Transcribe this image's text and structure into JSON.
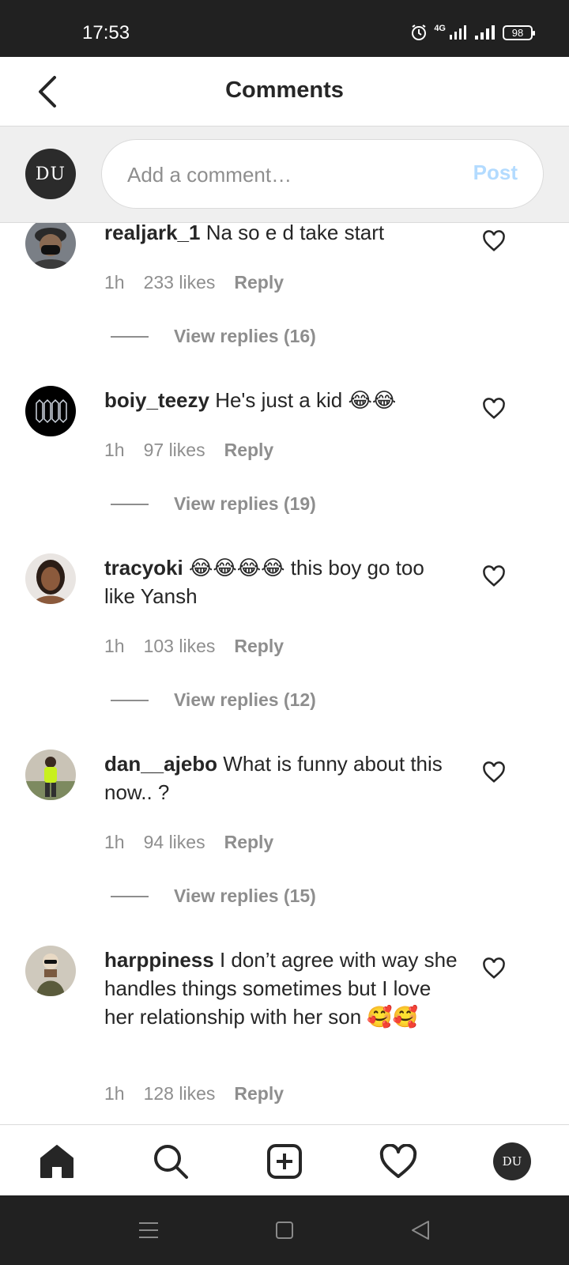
{
  "status_bar": {
    "time": "17:53",
    "network": "4G",
    "battery": "98"
  },
  "header": {
    "title": "Comments"
  },
  "composer": {
    "avatar_initials": "DU",
    "placeholder": "Add a comment…",
    "post_label": "Post"
  },
  "comments": [
    {
      "username": "realjark_1",
      "text": "Na so e d take start",
      "time": "1h",
      "likes": "233 likes",
      "reply": "Reply",
      "view_replies": "View replies (16)"
    },
    {
      "username": "boiy_teezy",
      "text": "He's just a kid 😂😂",
      "time": "1h",
      "likes": "97 likes",
      "reply": "Reply",
      "view_replies": "View replies (19)"
    },
    {
      "username": "tracyoki",
      "text": "😂😂😂😂 this boy go too like Yansh",
      "time": "1h",
      "likes": "103 likes",
      "reply": "Reply",
      "view_replies": "View replies (12)"
    },
    {
      "username": "dan__ajebo",
      "text": "What is funny about this now.. ?",
      "time": "1h",
      "likes": "94 likes",
      "reply": "Reply",
      "view_replies": "View replies (15)"
    },
    {
      "username": "harppiness",
      "text": "I don’t agree with way she handles things sometimes but I love her relationship with her son 🥰🥰",
      "time": "1h",
      "likes": "128 likes",
      "reply": "Reply"
    }
  ],
  "bottom_nav": {
    "profile_initials": "DU"
  },
  "icons": {
    "back": "chevron-left-icon",
    "like": "heart-outline-icon",
    "home": "home-icon",
    "search": "search-icon",
    "add": "plus-square-icon",
    "activity": "heart-icon",
    "system_menu": "menu-icon",
    "system_home": "square-icon",
    "system_back": "triangle-back-icon"
  },
  "colors": {
    "post_disabled": "#b3dbff",
    "meta_gray": "#8e8e8e",
    "system_bar": "#212121"
  }
}
